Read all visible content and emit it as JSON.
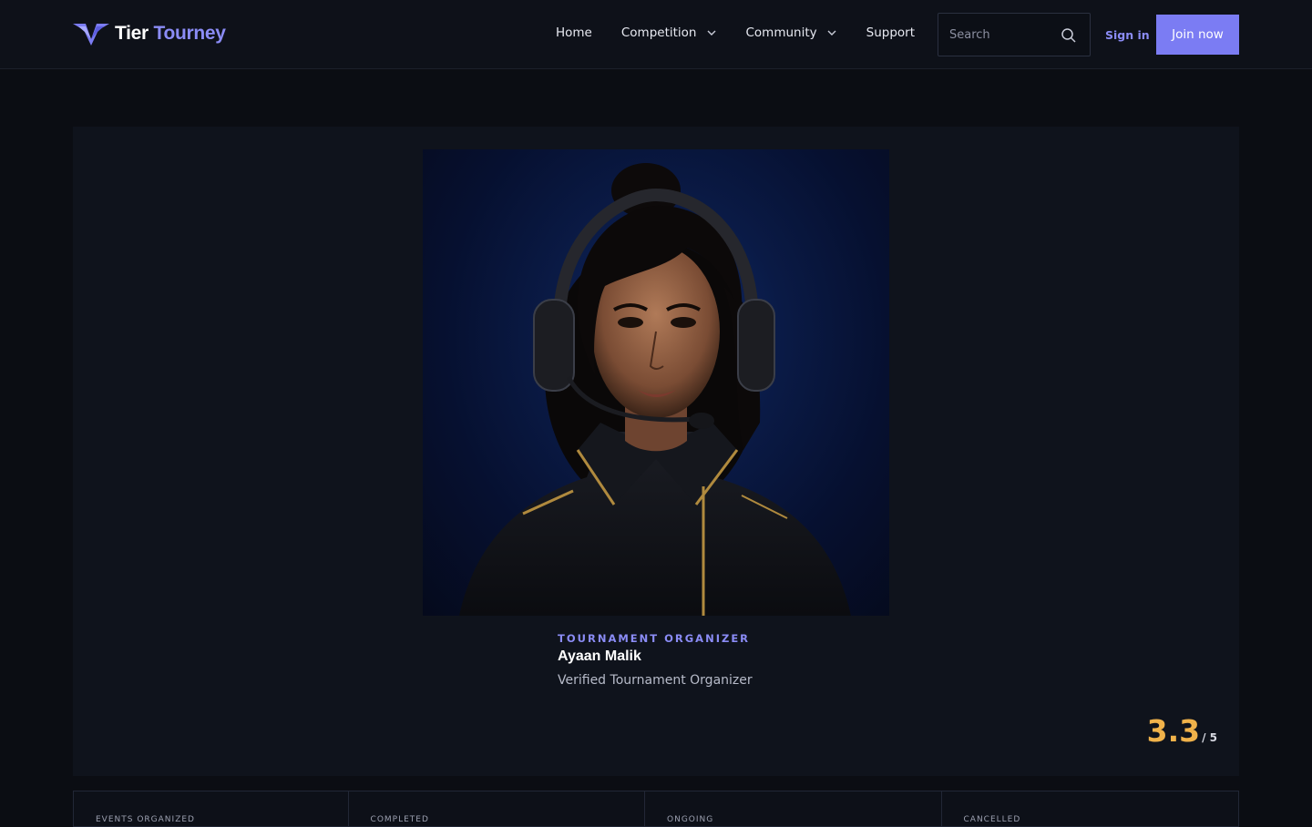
{
  "brand": {
    "word1": "Tier",
    "word2": "Tourney",
    "accent": "#8b8cf6"
  },
  "nav": {
    "items": [
      {
        "label": "Home",
        "dropdown": false
      },
      {
        "label": "Competition",
        "dropdown": true
      },
      {
        "label": "Community",
        "dropdown": true
      },
      {
        "label": "Support",
        "dropdown": false
      }
    ]
  },
  "search": {
    "placeholder": "Search",
    "icon": "search-icon"
  },
  "auth": {
    "signin_label": "Sign in",
    "join_label": "Join now"
  },
  "profile": {
    "role": "TOURNAMENT ORGANIZER",
    "name": "Ayaan Malik",
    "subtitle": "Verified Tournament Organizer",
    "rating": {
      "value": "3.3",
      "max": "/ 5",
      "color": "#f0b24a"
    }
  },
  "stats": [
    {
      "label": "EVENTS ORGANIZED"
    },
    {
      "label": "COMPLETED"
    },
    {
      "label": "ONGOING"
    },
    {
      "label": "CANCELLED"
    }
  ]
}
